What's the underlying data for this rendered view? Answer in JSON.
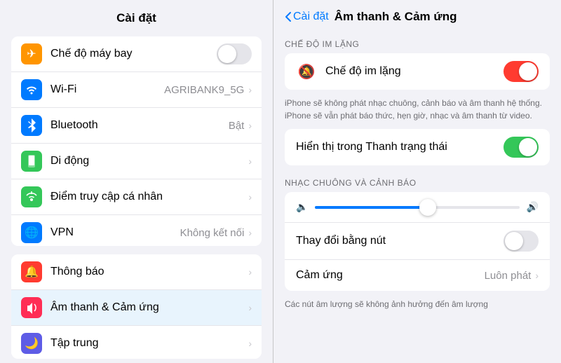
{
  "left": {
    "header": "Cài đặt",
    "group1": [
      {
        "id": "airplane",
        "icon": "✈",
        "iconClass": "icon-airplane",
        "label": "Chế độ máy bay",
        "value": "",
        "hasToggle": true,
        "hasChevron": false
      },
      {
        "id": "wifi",
        "icon": "📶",
        "iconClass": "icon-wifi",
        "label": "Wi-Fi",
        "value": "AGRIBANK9_5G",
        "hasToggle": false,
        "hasChevron": true
      },
      {
        "id": "bluetooth",
        "icon": "🔵",
        "iconClass": "icon-bluetooth",
        "label": "Bluetooth",
        "value": "Bật",
        "hasToggle": false,
        "hasChevron": true
      },
      {
        "id": "mobile",
        "icon": "📱",
        "iconClass": "icon-mobile",
        "label": "Di động",
        "value": "",
        "hasToggle": false,
        "hasChevron": true
      },
      {
        "id": "hotspot",
        "icon": "📡",
        "iconClass": "icon-hotspot",
        "label": "Điểm truy cập cá nhân",
        "value": "",
        "hasToggle": false,
        "hasChevron": true
      },
      {
        "id": "vpn",
        "icon": "🌐",
        "iconClass": "icon-vpn",
        "label": "VPN",
        "value": "Không kết nối",
        "hasToggle": false,
        "hasChevron": true
      }
    ],
    "group2": [
      {
        "id": "notifications",
        "icon": "🔔",
        "iconClass": "icon-notifications",
        "label": "Thông báo",
        "value": "",
        "hasToggle": false,
        "hasChevron": true
      },
      {
        "id": "sound",
        "icon": "🔊",
        "iconClass": "icon-sound",
        "label": "Âm thanh & Cảm ứng",
        "value": "",
        "hasToggle": false,
        "hasChevron": true
      },
      {
        "id": "focus",
        "icon": "🌙",
        "iconClass": "icon-focus",
        "label": "Tập trung",
        "value": "",
        "hasToggle": false,
        "hasChevron": true
      }
    ]
  },
  "right": {
    "backLabel": "Cài đặt",
    "title": "Âm thanh & Cảm ứng",
    "section1Header": "CHẾ ĐỘ IM LẶNG",
    "silentMode": {
      "label": "Chế độ im lặng",
      "toggleState": "on-red"
    },
    "silentDescription": "iPhone sẽ không phát nhạc chuông, cảnh báo và âm thanh hệ thống. iPhone sẽ vẫn phát báo thức, hẹn giờ, nhạc và âm thanh từ video.",
    "statusBarLabel": "Hiển thị trong Thanh trạng thái",
    "section2Header": "NHẠC CHUÔNG VÀ CẢNH BÁO",
    "changeWithButtons": {
      "label": "Thay đổi bằng nút",
      "toggleState": "off"
    },
    "haptics": {
      "label": "Cảm ứng",
      "value": "Luôn phát"
    },
    "hapticsNote": "Các nút âm lượng sẽ không ảnh hưởng đến âm lượng"
  }
}
